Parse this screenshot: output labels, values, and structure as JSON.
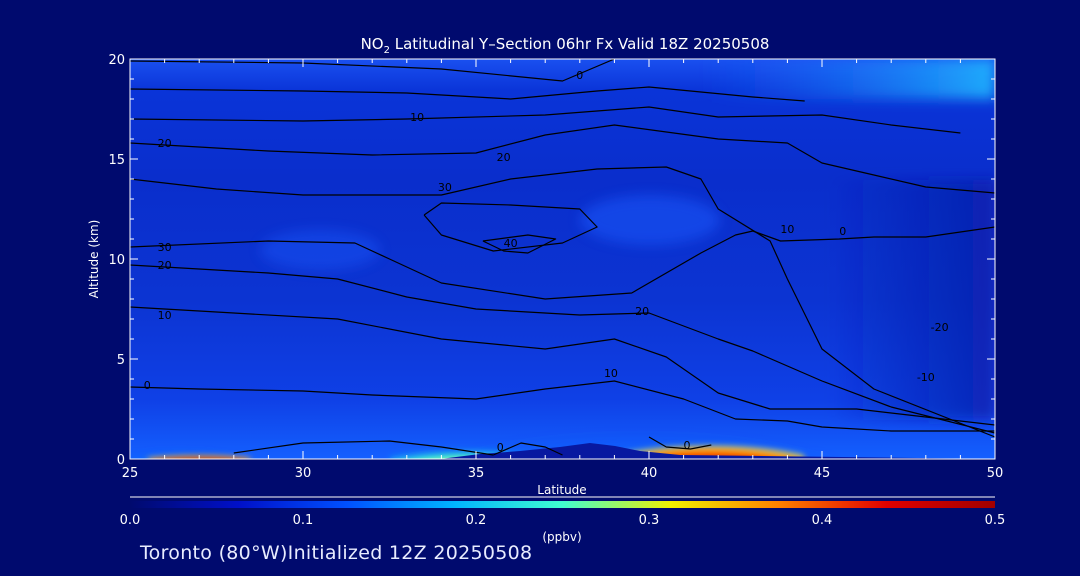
{
  "chart_data": {
    "type": "heatmap",
    "title_main": "NO",
    "title_sub": "2",
    "title_rest": " Latitudinal Y–Section 06hr  Fx Valid 18Z 20250508",
    "xlabel": "Latitude",
    "ylabel": "Altitude (km)",
    "xlim": [
      25,
      50
    ],
    "ylim": [
      0,
      20
    ],
    "x_ticks": [
      "25",
      "30",
      "35",
      "40",
      "45",
      "50"
    ],
    "y_ticks": [
      "0",
      "5",
      "10",
      "15",
      "20"
    ],
    "colorbar": {
      "range": [
        0.0,
        0.5
      ],
      "ticks": [
        "0.0",
        "0.1",
        "0.2",
        "0.3",
        "0.4",
        "0.5"
      ],
      "unit": "(ppbv)",
      "colors": [
        "#000a6e",
        "#0010c8",
        "#0050ff",
        "#00b4ff",
        "#40ffd0",
        "#f0f000",
        "#ff8000",
        "#e00000",
        "#a00000"
      ]
    },
    "no2_hotspots": [
      {
        "lat_range": [
          25.5,
          28.5
        ],
        "alt_top": 0.3,
        "value": 0.45
      },
      {
        "lat_range": [
          32.5,
          37.0
        ],
        "alt_top": 0.8,
        "value": 0.3
      },
      {
        "lat_range": [
          39.0,
          44.5
        ],
        "alt_top": 1.1,
        "value": 0.5
      }
    ],
    "contour_labels": [
      {
        "text": "0",
        "lat": 38.0,
        "alt": 19.2
      },
      {
        "text": "10",
        "lat": 33.3,
        "alt": 17.1
      },
      {
        "text": "20",
        "lat": 26.0,
        "alt": 15.8
      },
      {
        "text": "20",
        "lat": 35.8,
        "alt": 15.1
      },
      {
        "text": "30",
        "lat": 34.1,
        "alt": 13.6
      },
      {
        "text": "40",
        "lat": 36.0,
        "alt": 10.8
      },
      {
        "text": "30",
        "lat": 26.0,
        "alt": 10.6
      },
      {
        "text": "20",
        "lat": 26.0,
        "alt": 9.7
      },
      {
        "text": "10",
        "lat": 26.0,
        "alt": 7.2
      },
      {
        "text": "20",
        "lat": 39.8,
        "alt": 7.4
      },
      {
        "text": "10",
        "lat": 38.9,
        "alt": 4.3
      },
      {
        "text": "0",
        "lat": 25.5,
        "alt": 3.7
      },
      {
        "text": "10",
        "lat": 44.0,
        "alt": 11.5
      },
      {
        "text": "0",
        "lat": 45.6,
        "alt": 11.4
      },
      {
        "text": "-20",
        "lat": 48.4,
        "alt": 6.6
      },
      {
        "text": "-10",
        "lat": 48.0,
        "alt": 4.1
      },
      {
        "text": "0",
        "lat": 35.7,
        "alt": 0.6
      },
      {
        "text": "0",
        "lat": 41.1,
        "alt": 0.7
      }
    ],
    "contours": [
      [
        [
          25,
          19.9
        ],
        [
          30,
          19.8
        ],
        [
          34,
          19.5
        ],
        [
          37.5,
          18.9
        ],
        [
          39,
          20
        ]
      ],
      [
        [
          25,
          18.5
        ],
        [
          30,
          18.4
        ],
        [
          33,
          18.3
        ],
        [
          36,
          18.0
        ],
        [
          38.5,
          18.4
        ],
        [
          40,
          18.6
        ],
        [
          43,
          18.1
        ],
        [
          44.5,
          17.9
        ]
      ],
      [
        [
          25,
          17.0
        ],
        [
          30,
          16.9
        ],
        [
          33,
          17.0
        ],
        [
          37,
          17.2
        ],
        [
          40,
          17.6
        ],
        [
          42,
          17.1
        ],
        [
          45,
          17.2
        ],
        [
          47,
          16.7
        ],
        [
          49,
          16.3
        ]
      ],
      [
        [
          25,
          15.8
        ],
        [
          29,
          15.4
        ],
        [
          32,
          15.2
        ],
        [
          35,
          15.3
        ],
        [
          37,
          16.2
        ],
        [
          39,
          16.7
        ],
        [
          42,
          16.0
        ],
        [
          44,
          15.8
        ],
        [
          45,
          14.8
        ],
        [
          46.5,
          14.2
        ],
        [
          48,
          13.6
        ],
        [
          50,
          13.3
        ]
      ],
      [
        [
          25,
          14.0
        ],
        [
          27.5,
          13.5
        ],
        [
          30,
          13.2
        ],
        [
          32,
          13.2
        ],
        [
          34,
          13.2
        ],
        [
          36,
          14.0
        ],
        [
          38.5,
          14.5
        ],
        [
          40.5,
          14.6
        ],
        [
          41.5,
          14.0
        ],
        [
          42,
          12.5
        ],
        [
          43.5,
          10.9
        ],
        [
          44,
          9.0
        ],
        [
          45,
          5.5
        ],
        [
          46.5,
          3.5
        ],
        [
          50,
          1.1
        ]
      ],
      [
        [
          33.5,
          12.2
        ],
        [
          34,
          11.2
        ],
        [
          35.5,
          10.4
        ],
        [
          37.5,
          10.8
        ],
        [
          38.5,
          11.6
        ],
        [
          38,
          12.5
        ],
        [
          36,
          12.7
        ],
        [
          34,
          12.8
        ],
        [
          33.5,
          12.2
        ]
      ],
      [
        [
          35.2,
          10.9
        ],
        [
          36.5,
          11.2
        ],
        [
          37.3,
          11.0
        ],
        [
          36.5,
          10.3
        ],
        [
          35.8,
          10.4
        ],
        [
          35.2,
          10.9
        ]
      ],
      [
        [
          25,
          10.6
        ],
        [
          29,
          10.9
        ],
        [
          31.5,
          10.8
        ],
        [
          32.5,
          10.0
        ],
        [
          34,
          8.8
        ],
        [
          37,
          8.0
        ],
        [
          39.5,
          8.3
        ],
        [
          41.5,
          10.3
        ],
        [
          42.5,
          11.2
        ],
        [
          43,
          11.4
        ],
        [
          43.8,
          10.9
        ],
        [
          45.5,
          11.0
        ],
        [
          46.5,
          11.1
        ],
        [
          48,
          11.1
        ],
        [
          50,
          11.6
        ]
      ],
      [
        [
          25,
          9.7
        ],
        [
          29,
          9.3
        ],
        [
          31,
          9.0
        ],
        [
          33,
          8.1
        ],
        [
          35,
          7.5
        ],
        [
          38,
          7.2
        ],
        [
          40,
          7.3
        ],
        [
          42,
          6.0
        ],
        [
          43,
          5.4
        ],
        [
          45,
          3.9
        ],
        [
          47,
          2.6
        ],
        [
          50,
          1.3
        ]
      ],
      [
        [
          25,
          7.6
        ],
        [
          28,
          7.3
        ],
        [
          31,
          7.0
        ],
        [
          34,
          6.0
        ],
        [
          37,
          5.5
        ],
        [
          39,
          6.0
        ],
        [
          40.5,
          5.1
        ],
        [
          42,
          3.3
        ],
        [
          43.5,
          2.5
        ],
        [
          45,
          2.5
        ],
        [
          46,
          2.5
        ],
        [
          48,
          2.1
        ],
        [
          50,
          1.7
        ]
      ],
      [
        [
          25,
          3.6
        ],
        [
          27,
          3.5
        ],
        [
          30,
          3.4
        ],
        [
          32,
          3.2
        ],
        [
          35,
          3.0
        ],
        [
          37,
          3.5
        ],
        [
          39,
          3.9
        ],
        [
          41,
          3.0
        ],
        [
          42.5,
          2.0
        ],
        [
          44,
          1.9
        ],
        [
          45,
          1.6
        ],
        [
          47,
          1.4
        ],
        [
          50,
          1.4
        ]
      ],
      [
        [
          28,
          0.3
        ],
        [
          30,
          0.8
        ],
        [
          32.5,
          0.9
        ],
        [
          34,
          0.6
        ],
        [
          35.5,
          0.2
        ]
      ],
      [
        [
          35.5,
          0.2
        ],
        [
          36.3,
          0.8
        ],
        [
          37.0,
          0.6
        ],
        [
          37.5,
          0.2
        ]
      ],
      [
        [
          40,
          1.1
        ],
        [
          40.5,
          0.6
        ],
        [
          41.2,
          0.5
        ],
        [
          41.8,
          0.7
        ]
      ]
    ]
  },
  "footer": {
    "location": "Toronto (80°W)",
    "initialized": "Initialized 12Z 20250508"
  }
}
